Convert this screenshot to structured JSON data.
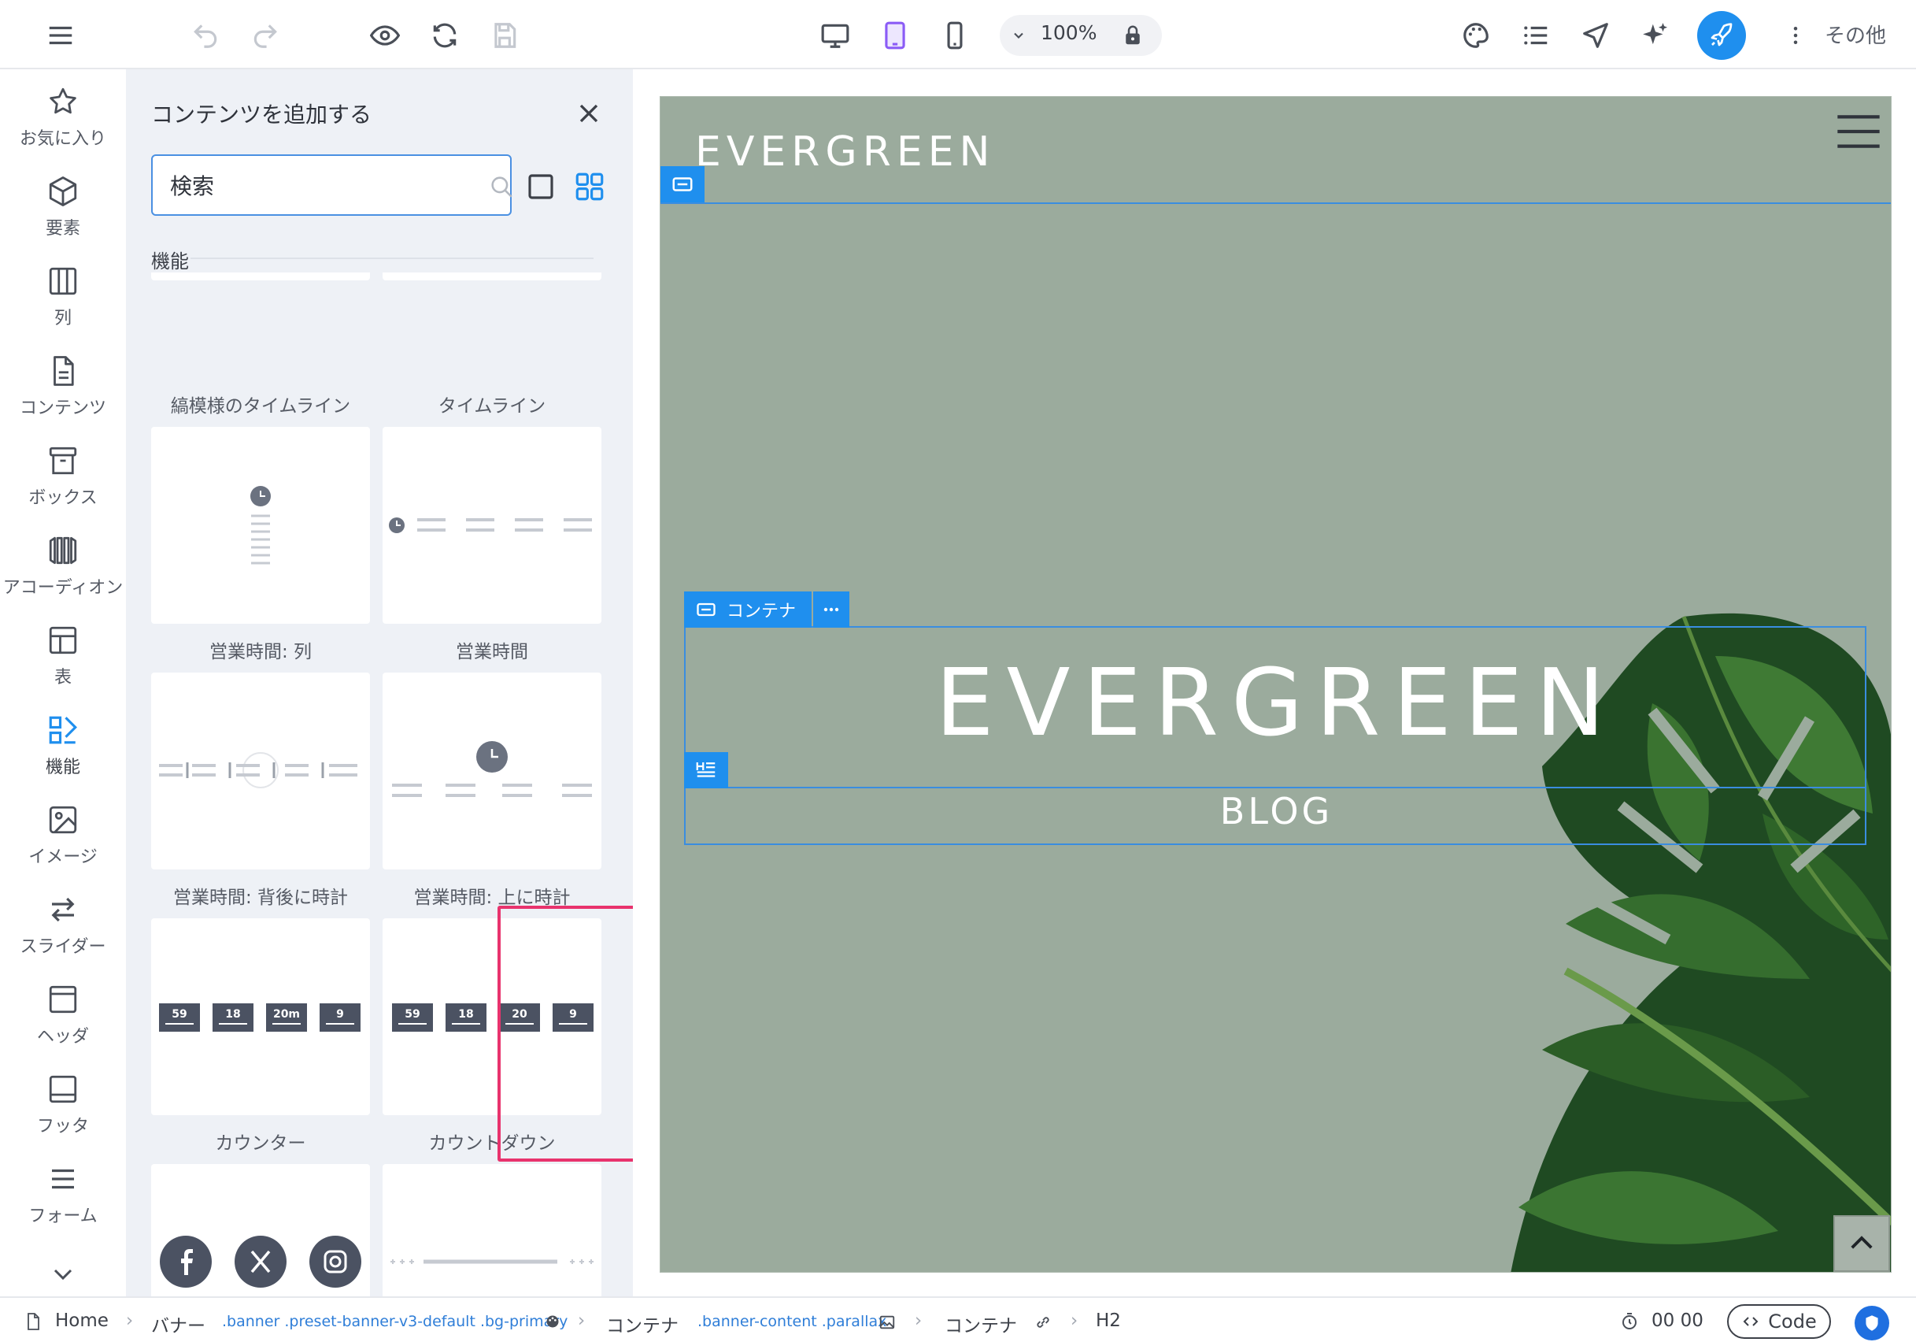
{
  "toolbar": {
    "zoom": "100%",
    "more_label": "その他"
  },
  "rail": {
    "items": [
      {
        "label": "お気に入り"
      },
      {
        "label": "要素"
      },
      {
        "label": "列"
      },
      {
        "label": "コンテンツ"
      },
      {
        "label": "ボックス"
      },
      {
        "label": "アコーディオン"
      },
      {
        "label": "表"
      },
      {
        "label": "機能",
        "active": true
      },
      {
        "label": "イメージ"
      },
      {
        "label": "スライダー"
      },
      {
        "label": "ヘッダ"
      },
      {
        "label": "フッタ"
      },
      {
        "label": "フォーム"
      }
    ]
  },
  "panel": {
    "title": "コンテンツを追加する",
    "search": {
      "value": "検索",
      "placeholder": "検索"
    },
    "section": "機能",
    "cards": [
      {
        "label": "縞模様のタイムライン"
      },
      {
        "label": "タイムライン"
      },
      {
        "label": "営業時間: 列"
      },
      {
        "label": "営業時間"
      },
      {
        "label": "営業時間: 背後に時計"
      },
      {
        "label": "営業時間: 上に時計"
      },
      {
        "label": "カウンター",
        "values": [
          "59",
          "18",
          "20m",
          "9"
        ]
      },
      {
        "label": "カウントダウン",
        "values": [
          "59",
          "18",
          "20",
          "9"
        ],
        "highlighted": true
      }
    ]
  },
  "preview": {
    "logo": "EVERGREEN",
    "container_tag": "コンテナ",
    "hero_title": "EVERGREEN",
    "hero_subtitle": "BLOG",
    "background_color": "#9bab9d"
  },
  "breadcrumb": {
    "home": "Home",
    "banner": "バナー",
    "banner_classes": ".banner .preset-banner-v3-default .bg-primary",
    "container1": "コンテナ",
    "container1_classes": ".banner-content .parallax",
    "container2": "コンテナ",
    "current": "H2"
  },
  "status": {
    "timer": "00 00",
    "code_label": "Code"
  },
  "colors": {
    "accent": "#1f8fee",
    "highlight": "#e8336d",
    "active_device": "#8b5cf6"
  }
}
